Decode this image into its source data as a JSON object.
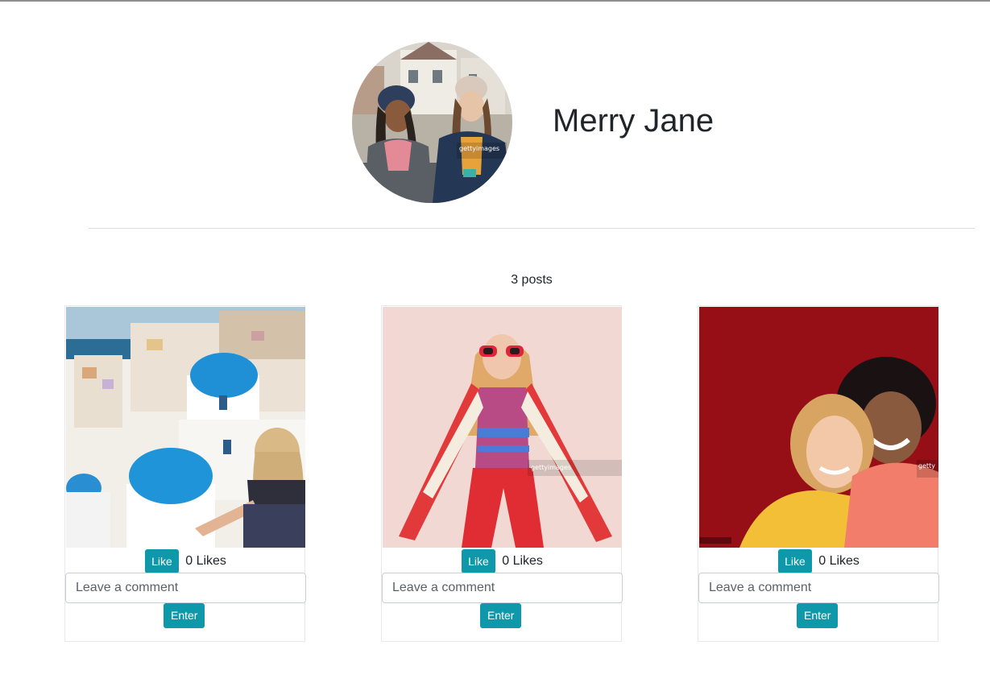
{
  "profile": {
    "name": "Merry Jane",
    "avatar_alt": "profile photo"
  },
  "posts_summary": "3 posts",
  "posts": [
    {
      "image_alt": "Santorini blue domes photo",
      "like_label": "Like",
      "likes_text": "0 Likes",
      "comment_placeholder": "Leave a comment",
      "enter_label": "Enter"
    },
    {
      "image_alt": "woman in red scarf photo",
      "like_label": "Like",
      "likes_text": "0 Likes",
      "comment_placeholder": "Leave a comment",
      "enter_label": "Enter"
    },
    {
      "image_alt": "two women selfie photo",
      "like_label": "Like",
      "likes_text": "0 Likes",
      "comment_placeholder": "Leave a comment",
      "enter_label": "Enter"
    }
  ],
  "colors": {
    "accent": "#0f98a9",
    "text": "#212529",
    "divider": "#dcdcdc"
  }
}
